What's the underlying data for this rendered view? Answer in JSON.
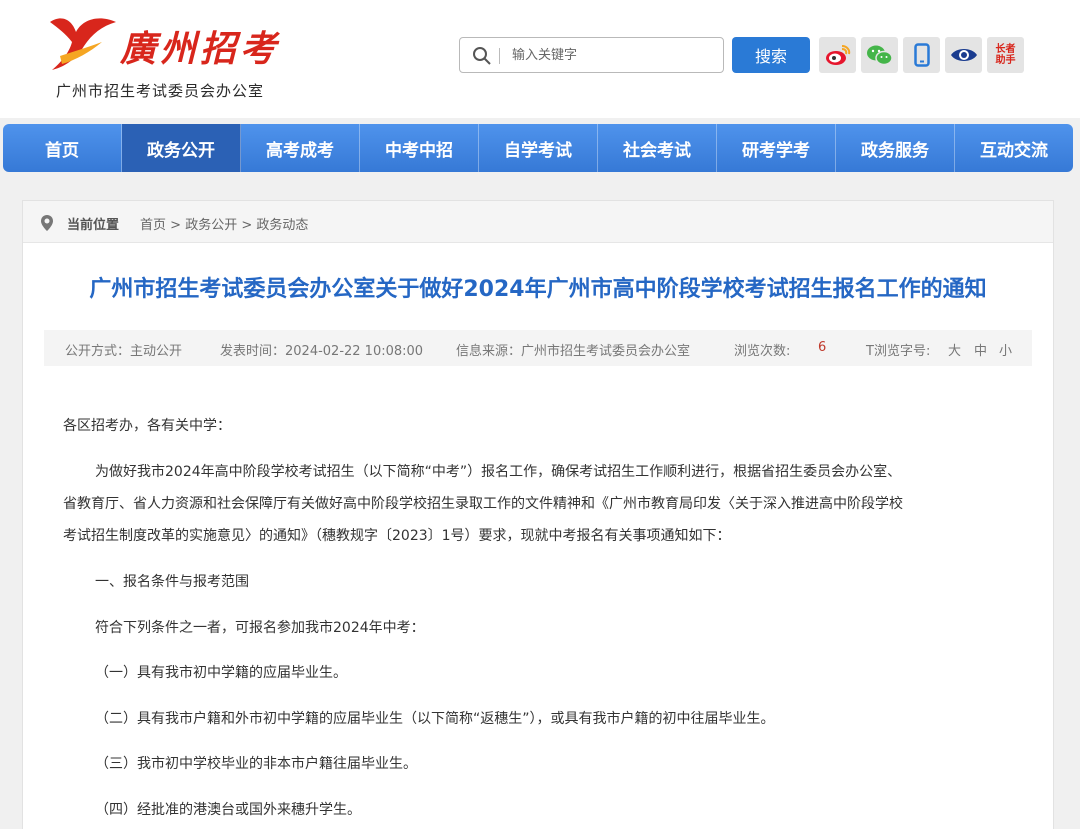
{
  "header": {
    "logo_text": "廣州招考",
    "subtitle": "广州市招生考试委员会办公室"
  },
  "search": {
    "placeholder": "输入关键字",
    "button_label": "搜索"
  },
  "social": {
    "elder_line1": "长者",
    "elder_line2": "助手"
  },
  "nav": {
    "items": [
      {
        "label": "首页"
      },
      {
        "label": "政务公开"
      },
      {
        "label": "高考成考"
      },
      {
        "label": "中考中招"
      },
      {
        "label": "自学考试"
      },
      {
        "label": "社会考试"
      },
      {
        "label": "研考学考"
      },
      {
        "label": "政务服务"
      },
      {
        "label": "互动交流"
      }
    ],
    "active_index": 1
  },
  "breadcrumb": {
    "current_label": "当前位置",
    "items": [
      "首页",
      "政务公开",
      "政务动态"
    ],
    "separator": ">"
  },
  "article": {
    "title": "广州市招生考试委员会办公室关于做好2024年广州市高中阶段学校考试招生报名工作的通知",
    "meta": {
      "open_mode": "公开方式：主动公开",
      "publish_time": "发表时间：2024-02-22 10:08:00",
      "source": "信息来源：广州市招生考试委员会办公室",
      "views_label": "浏览次数:",
      "views_value": "6",
      "font_label": "T浏览字号:",
      "font_large": "大",
      "font_medium": "中",
      "font_small": "小"
    },
    "paragraphs": [
      "各区招考办，各有关中学：",
      "为做好我市2024年高中阶段学校考试招生（以下简称“中考”）报名工作，确保考试招生工作顺利进行，根据省招生委员会办公室、",
      "省教育厅、省人力资源和社会保障厅有关做好高中阶段学校招生录取工作的文件精神和《广州市教育局印发〈关于深入推进高中阶段学校",
      "考试招生制度改革的实施意见〉的通知》（穗教规字〔2023〕1号）要求，现就中考报名有关事项通知如下：",
      "一、报名条件与报考范围",
      "符合下列条件之一者，可报名参加我市2024年中考：",
      "（一）具有我市初中学籍的应届毕业生。",
      "（二）具有我市户籍和外市初中学籍的应届毕业生（以下简称“返穗生”），或具有我市户籍的初中往届毕业生。",
      "（三）我市初中学校毕业的非本市户籍往届毕业生。",
      "（四）经批准的港澳台或国外来穗升学生。"
    ]
  },
  "colors": {
    "brand_red": "#d8261c",
    "nav_blue": "#3679d6",
    "nav_active": "#2b61b5",
    "title_blue": "#2567c4",
    "views_red": "#c0392b"
  }
}
